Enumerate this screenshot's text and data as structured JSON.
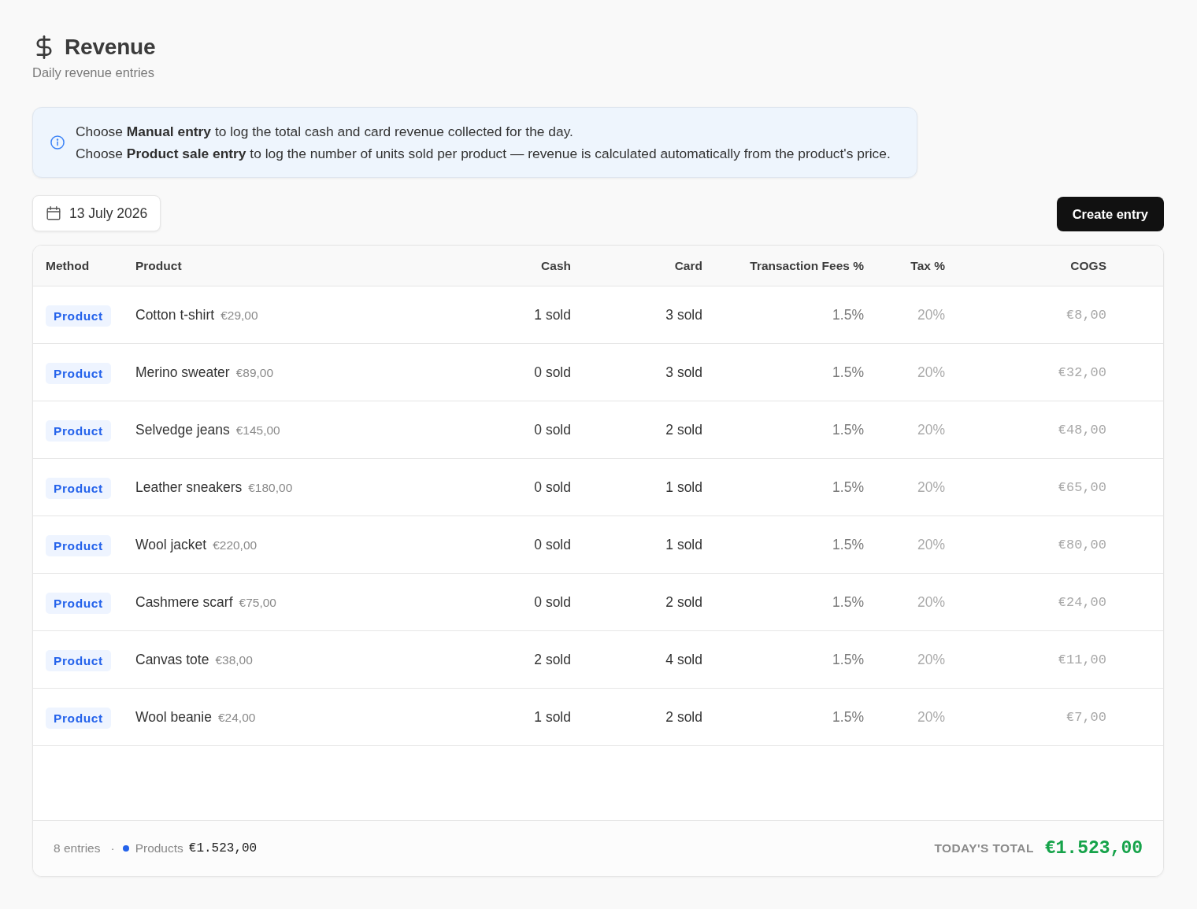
{
  "header": {
    "title": "Revenue",
    "subtitle": "Daily revenue entries"
  },
  "info_banner": {
    "lines": [
      "Choose **Manual entry** to log the total cash and card revenue collected for the day.",
      "Choose **Product sale entry** to log the number of units sold per product — revenue is calculated automatically from the product's price."
    ]
  },
  "toolbar": {
    "date": "13 July 2026",
    "create_button": "Create entry"
  },
  "table": {
    "columns": [
      "Method",
      "Product",
      "Cash",
      "Card",
      "Transaction Fees %",
      "Tax %",
      "COGS"
    ],
    "rows": [
      {
        "method": "Product",
        "product": "Cotton t-shirt",
        "price": "€29,00",
        "cash": "1 sold",
        "card": "3 sold",
        "fees": "1.5%",
        "tax": "20%",
        "cogs": "€8,00"
      },
      {
        "method": "Product",
        "product": "Merino sweater",
        "price": "€89,00",
        "cash": "0 sold",
        "card": "3 sold",
        "fees": "1.5%",
        "tax": "20%",
        "cogs": "€32,00"
      },
      {
        "method": "Product",
        "product": "Selvedge jeans",
        "price": "€145,00",
        "cash": "0 sold",
        "card": "2 sold",
        "fees": "1.5%",
        "tax": "20%",
        "cogs": "€48,00"
      },
      {
        "method": "Product",
        "product": "Leather sneakers",
        "price": "€180,00",
        "cash": "0 sold",
        "card": "1 sold",
        "fees": "1.5%",
        "tax": "20%",
        "cogs": "€65,00"
      },
      {
        "method": "Product",
        "product": "Wool jacket",
        "price": "€220,00",
        "cash": "0 sold",
        "card": "1 sold",
        "fees": "1.5%",
        "tax": "20%",
        "cogs": "€80,00"
      },
      {
        "method": "Product",
        "product": "Cashmere scarf",
        "price": "€75,00",
        "cash": "0 sold",
        "card": "2 sold",
        "fees": "1.5%",
        "tax": "20%",
        "cogs": "€24,00"
      },
      {
        "method": "Product",
        "product": "Canvas tote",
        "price": "€38,00",
        "cash": "2 sold",
        "card": "4 sold",
        "fees": "1.5%",
        "tax": "20%",
        "cogs": "€11,00"
      },
      {
        "method": "Product",
        "product": "Wool beanie",
        "price": "€24,00",
        "cash": "1 sold",
        "card": "2 sold",
        "fees": "1.5%",
        "tax": "20%",
        "cogs": "€7,00"
      }
    ]
  },
  "footer": {
    "entries": "8 entries",
    "separator": "·",
    "legend": [
      {
        "label": "Products",
        "color": "#2563eb",
        "amount": "€1.523,00"
      }
    ],
    "total_label": "TODAY'S TOTAL",
    "total": "€1.523,00"
  }
}
